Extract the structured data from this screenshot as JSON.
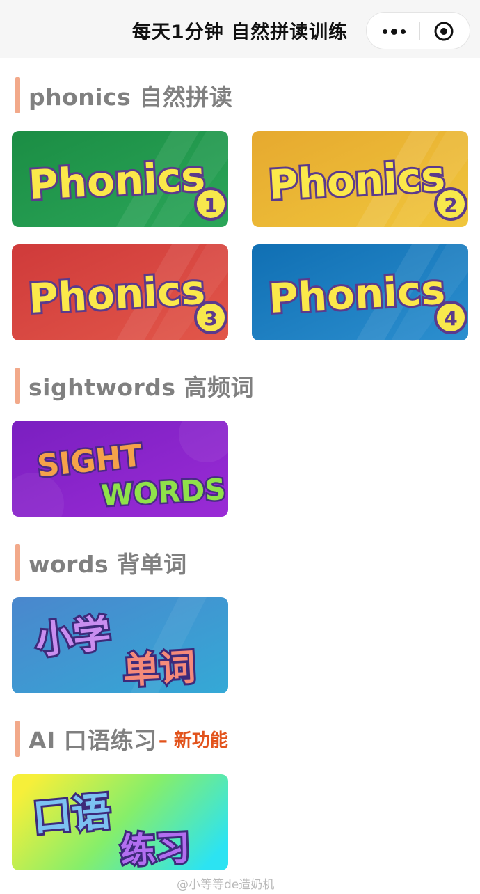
{
  "nav": {
    "title": "每天1分钟 自然拼读训练",
    "more_icon": "more-dots-icon",
    "close_icon": "target-circle-icon"
  },
  "sections": [
    {
      "title": "phonics 自然拼读"
    },
    {
      "title": "sightwords 高频词"
    },
    {
      "title": "words 背单词"
    },
    {
      "title": "AI 口语练习",
      "tag": "– 新功能"
    }
  ],
  "cards": {
    "phonics": [
      {
        "word": "Phonics",
        "level": "1",
        "bg": "#1f9a4a"
      },
      {
        "word": "Phonics",
        "level": "2",
        "bg": "#eab534"
      },
      {
        "word": "Phonics",
        "level": "3",
        "bg": "#d8423f"
      },
      {
        "word": "Phonics",
        "level": "4",
        "bg": "#1579bd"
      }
    ],
    "sight": {
      "line1": "SIGHT",
      "line2": "WORDS",
      "bg": "#8a22c9"
    },
    "words": {
      "line1": "小学",
      "line2": "单词",
      "bg": "#3f8ec8"
    },
    "speak": {
      "line1": "口语",
      "line2": "练习"
    }
  },
  "watermark": "@小等等de造奶机"
}
